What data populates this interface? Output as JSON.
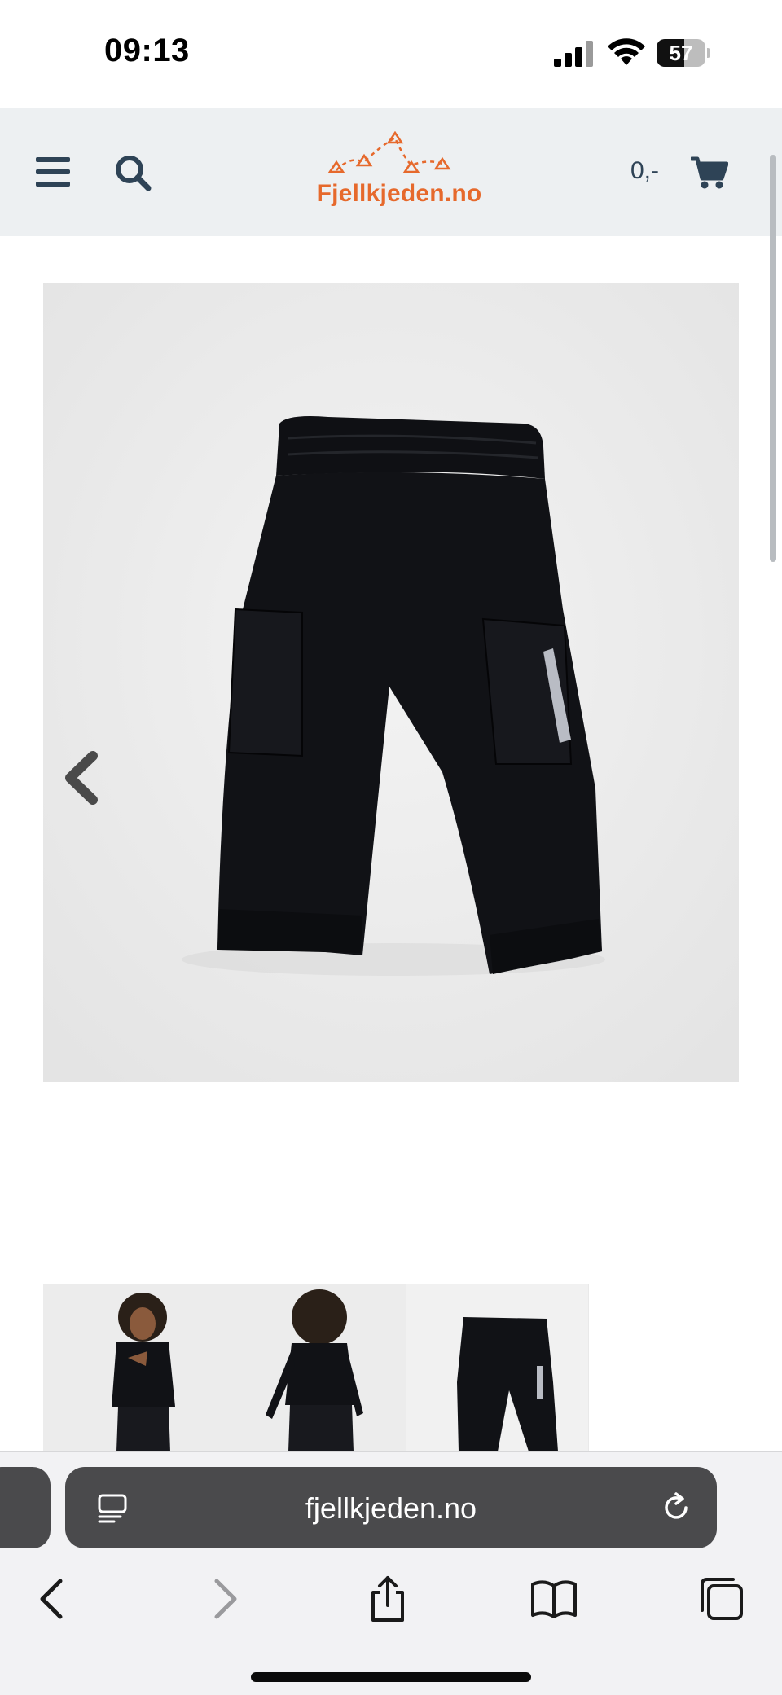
{
  "status_bar": {
    "time": "09:13",
    "battery_level": "57",
    "battery_fraction": 0.57
  },
  "header": {
    "logo_text": "Fjellkjeden.no",
    "cart_total": "0,-",
    "brand_color": "#e6692c",
    "icon_color": "#2e4356",
    "icons": [
      "menu-icon",
      "search-icon",
      "cart-icon"
    ]
  },
  "gallery": {
    "main_image": "black cargo pants with reflective strip",
    "prev_icon": "chevron-left-icon",
    "thumbnails": [
      "child wearing black outfit, front view",
      "child wearing black outfit, back view",
      "black cargo pants product shot"
    ]
  },
  "browser": {
    "url": "fjellkjeden.no",
    "icons": [
      "reader-icon",
      "reload-icon",
      "back-icon",
      "forward-icon",
      "share-icon",
      "bookmarks-icon",
      "tabs-icon"
    ]
  }
}
